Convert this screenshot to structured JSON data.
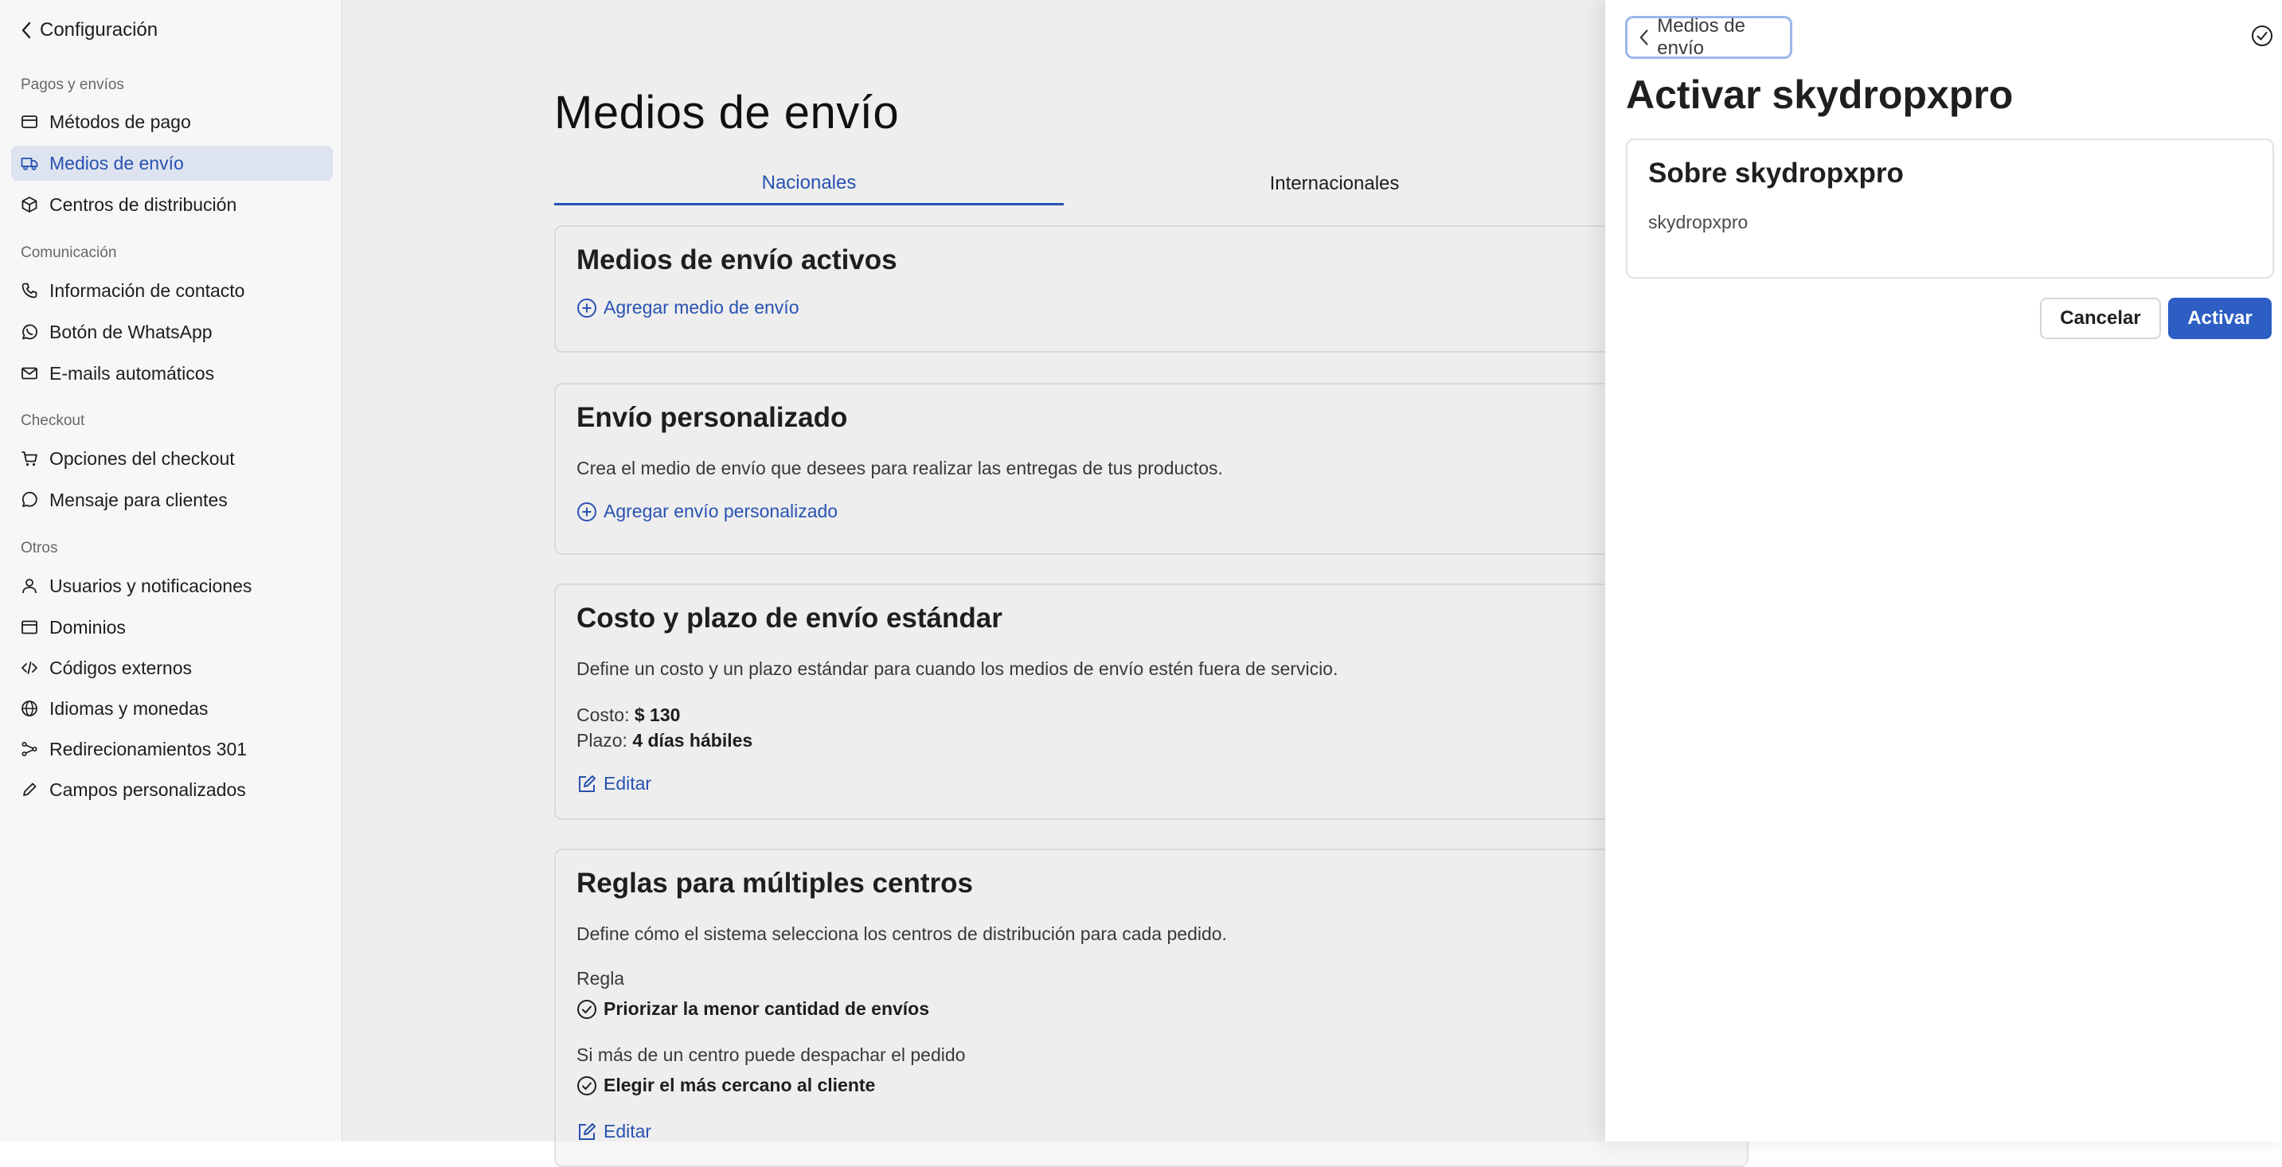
{
  "sidebar": {
    "back_label": "Configuración",
    "groups": [
      {
        "title": "Pagos y envíos",
        "items": [
          {
            "label": "Métodos de pago",
            "icon": "credit-card-icon"
          },
          {
            "label": "Medios de envío",
            "icon": "truck-icon",
            "active": true
          },
          {
            "label": "Centros de distribución",
            "icon": "box-icon"
          }
        ]
      },
      {
        "title": "Comunicación",
        "items": [
          {
            "label": "Información de contacto",
            "icon": "phone-icon"
          },
          {
            "label": "Botón de WhatsApp",
            "icon": "whatsapp-icon"
          },
          {
            "label": "E-mails automáticos",
            "icon": "mail-icon"
          }
        ]
      },
      {
        "title": "Checkout",
        "items": [
          {
            "label": "Opciones del checkout",
            "icon": "cart-icon"
          },
          {
            "label": "Mensaje para clientes",
            "icon": "chat-icon"
          }
        ]
      },
      {
        "title": "Otros",
        "items": [
          {
            "label": "Usuarios y notificaciones",
            "icon": "user-icon"
          },
          {
            "label": "Dominios",
            "icon": "browser-icon"
          },
          {
            "label": "Códigos externos",
            "icon": "code-icon"
          },
          {
            "label": "Idiomas y monedas",
            "icon": "globe-icon"
          },
          {
            "label": "Redirecionamientos 301",
            "icon": "redirect-icon"
          },
          {
            "label": "Campos personalizados",
            "icon": "pencil-icon"
          }
        ]
      }
    ]
  },
  "main": {
    "title": "Medios de envío",
    "tabs": [
      {
        "label": "Nacionales",
        "active": true
      },
      {
        "label": "Internacionales"
      }
    ],
    "active_methods": {
      "title": "Medios de envío activos",
      "add_link": "Agregar medio de envío"
    },
    "custom_shipping": {
      "title": "Envío personalizado",
      "description": "Crea el medio de envío que desees para realizar las entregas de tus productos.",
      "add_link": "Agregar envío personalizado"
    },
    "standard": {
      "title": "Costo y plazo de envío estándar",
      "description": "Define un costo y un plazo estándar para cuando los medios de envío estén fuera de servicio.",
      "cost_label": "Costo:",
      "cost_value": "$ 130",
      "term_label": "Plazo:",
      "term_value": "4 días hábiles",
      "edit_link": "Editar"
    },
    "rules": {
      "title": "Reglas para múltiples centros",
      "description": "Define cómo el sistema selecciona los centros de distribución para cada pedido.",
      "rule_label": "Regla",
      "rule_value": "Priorizar la menor cantidad de envíos",
      "multi_label": "Si más de un centro puede despachar el pedido",
      "multi_value": "Elegir el más cercano al cliente",
      "edit_link": "Editar"
    }
  },
  "panel": {
    "back_label": "Medios de envío",
    "title": "Activar skydropxpro",
    "info_title": "Sobre skydropxpro",
    "info_text": "skydropxpro",
    "cancel_label": "Cancelar",
    "activate_label": "Activar"
  },
  "colors": {
    "accent": "#2a55b8",
    "primary_button": "#2d5ec4",
    "active_nav_bg": "#e6ecf7",
    "focus_ring": "#9bb7ec"
  }
}
